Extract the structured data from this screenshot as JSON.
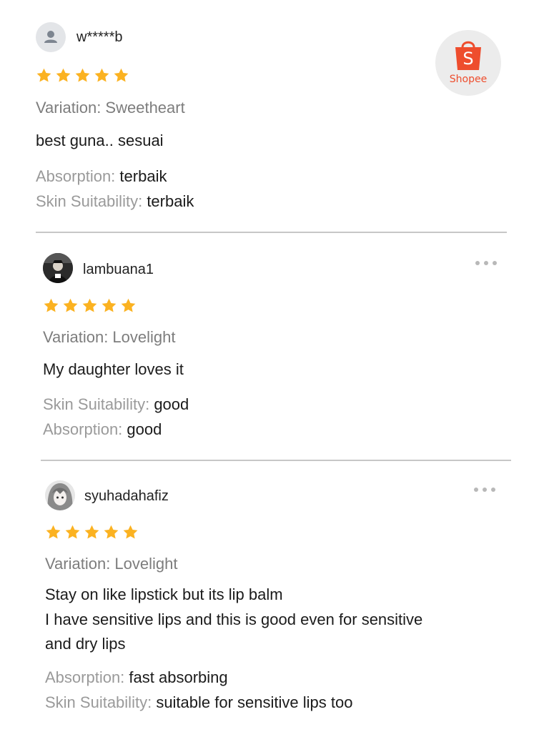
{
  "logo": {
    "text": "Shopee",
    "color": "#ee4d2d"
  },
  "colors": {
    "star": "#fbb221",
    "divider": "#c7c7c7",
    "muted_text": "#9a9a9a"
  },
  "reviews": [
    {
      "username": "w*****b",
      "avatar": "default-person-icon",
      "rating": 5,
      "variation": "Variation: Sweetheart",
      "comment": [
        "best guna.. sesuai"
      ],
      "attributes": [
        {
          "key": "Absorption:",
          "value": "terbaik"
        },
        {
          "key": "Skin Suitability:",
          "value": "terbaik"
        }
      ]
    },
    {
      "username": "lambuana1",
      "avatar": "user-photo",
      "rating": 5,
      "variation": "Variation: Lovelight",
      "comment": [
        "My daughter loves it"
      ],
      "attributes": [
        {
          "key": "Skin Suitability:",
          "value": "good"
        },
        {
          "key": "Absorption:",
          "value": "good"
        }
      ]
    },
    {
      "username": "syuhadahafiz",
      "avatar": "user-photo",
      "rating": 5,
      "variation": "Variation: Lovelight",
      "comment": [
        "Stay on like lipstick but its lip balm",
        "I have sensitive lips and this is good even for sensitive",
        "and dry lips"
      ],
      "attributes": [
        {
          "key": "Absorption:",
          "value": "fast absorbing"
        },
        {
          "key": "Skin Suitability:",
          "value": "suitable for sensitive lips too"
        }
      ]
    }
  ]
}
